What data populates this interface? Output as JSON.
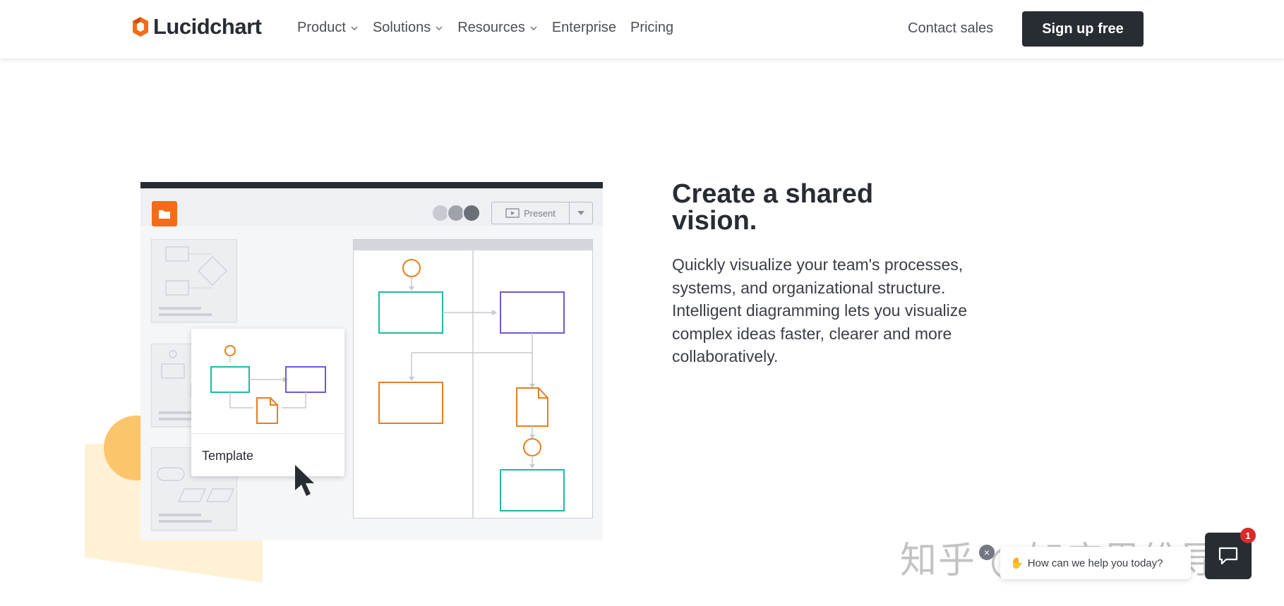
{
  "nav": {
    "logo_text": "Lucidchart",
    "links": [
      {
        "label": "Product",
        "has_dropdown": true
      },
      {
        "label": "Solutions",
        "has_dropdown": true
      },
      {
        "label": "Resources",
        "has_dropdown": true
      },
      {
        "label": "Enterprise",
        "has_dropdown": false
      },
      {
        "label": "Pricing",
        "has_dropdown": false
      }
    ],
    "contact_label": "Contact sales",
    "signup_label": "Sign up free"
  },
  "mockup": {
    "present_label": "Present",
    "template_label": "Template"
  },
  "feature": {
    "headline_line1": "Create a shared",
    "headline_line2": "vision.",
    "body": "Quickly visualize your team's processes, systems, and organizational structure. Intelligent diagramming lets you visualize complex ideas faster, clearer and more collaboratively."
  },
  "chat": {
    "prompt": "How can we help you today?",
    "badge_count": "1",
    "close_glyph": "×"
  },
  "watermark": "知乎 @知序思维导图",
  "colors": {
    "brand_dark": "#282c33",
    "brand_orange": "#f46c17",
    "teal": "#1fb8a4",
    "purple": "#6c5ad6",
    "shape_orange": "#e67e22",
    "accent_yellow": "#fdc56b"
  }
}
